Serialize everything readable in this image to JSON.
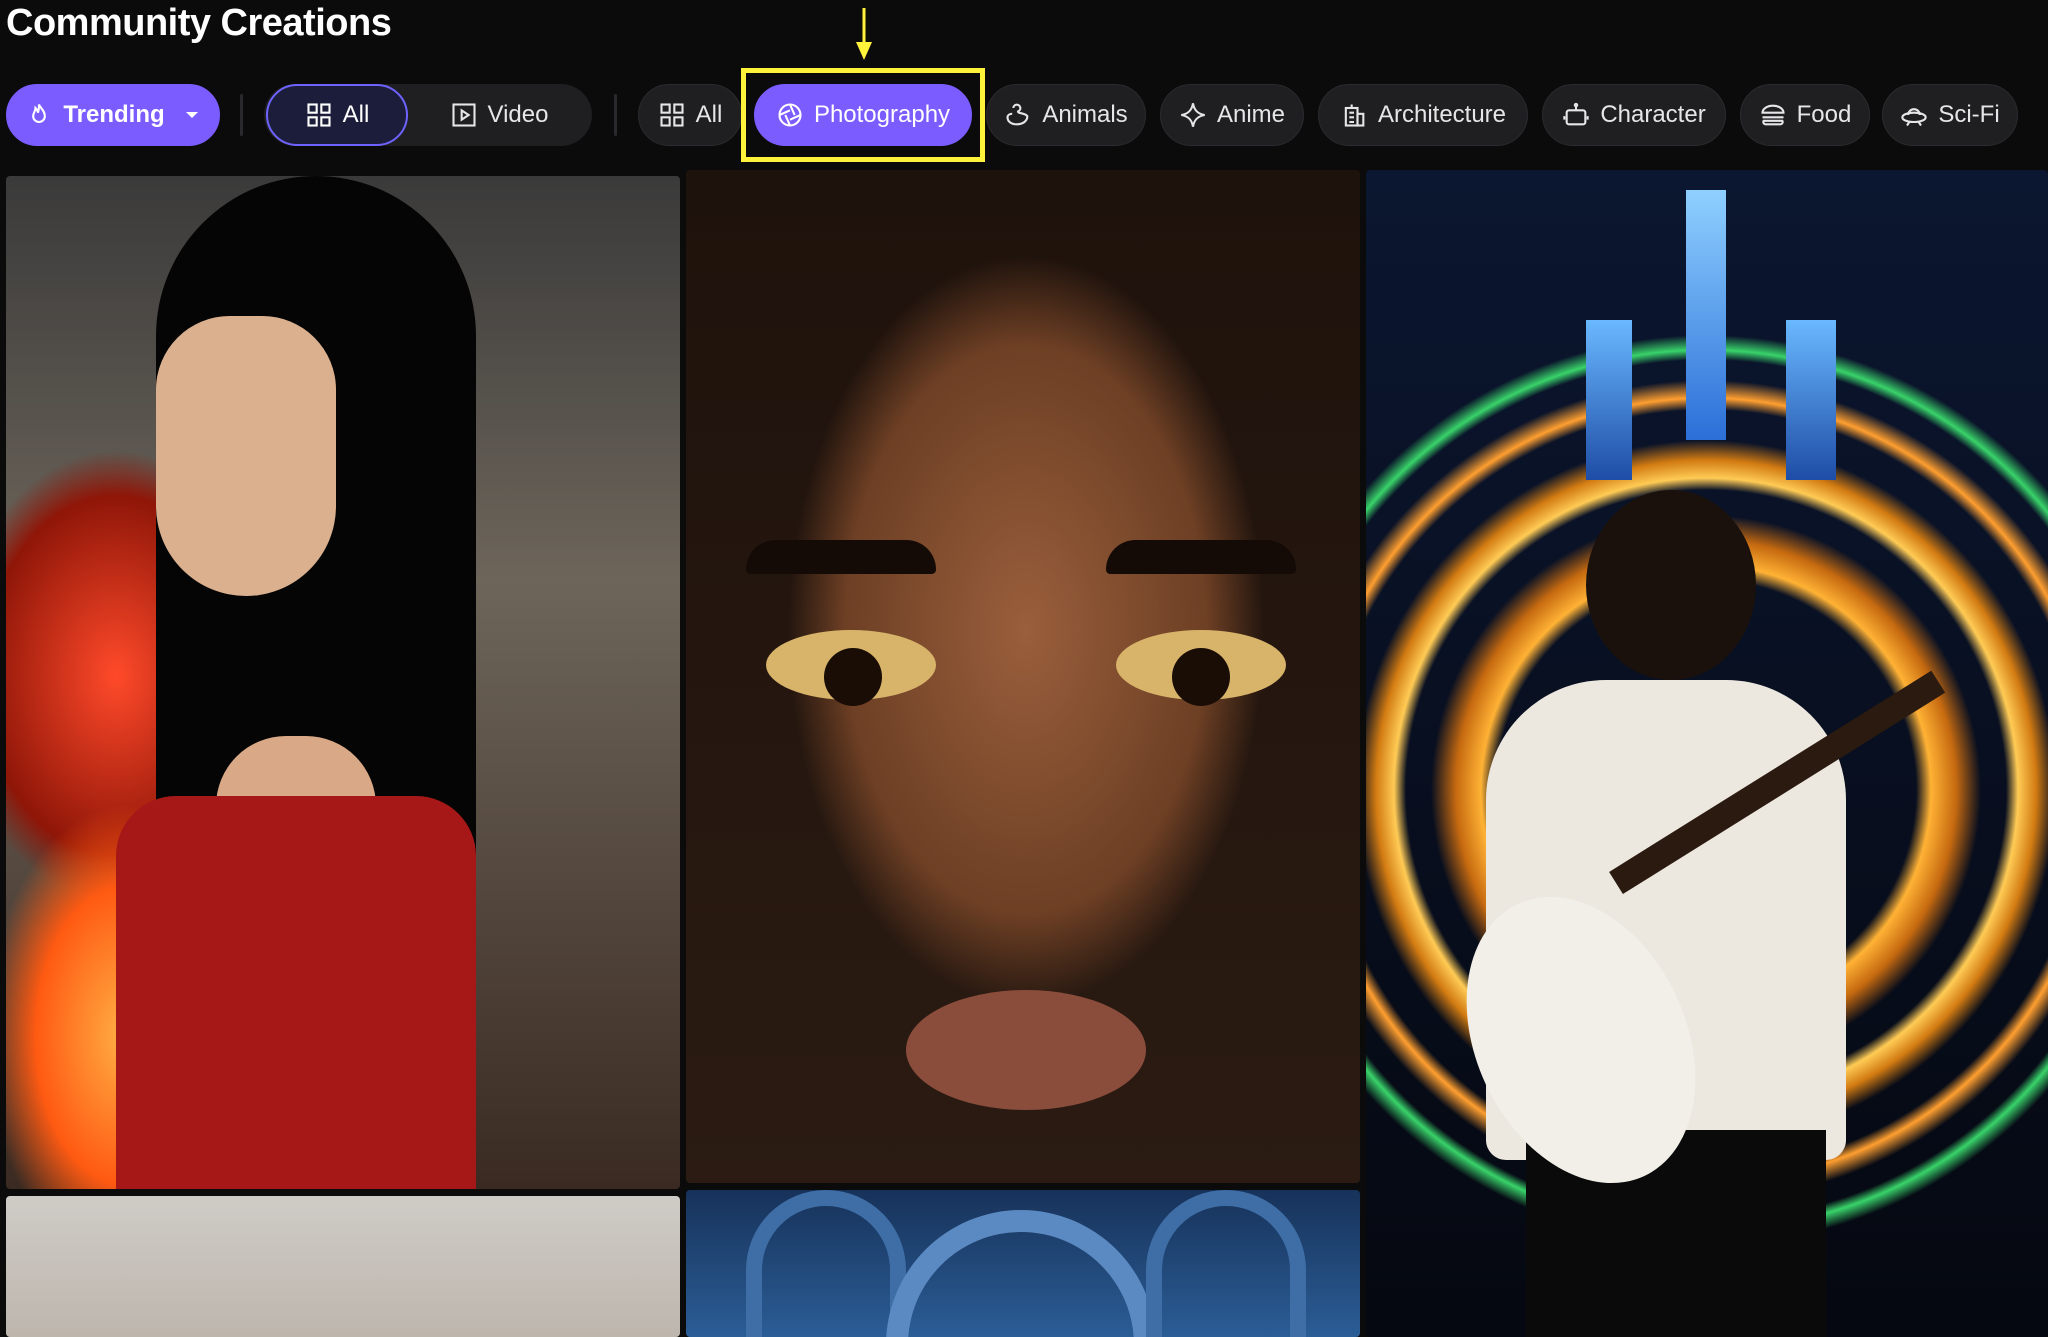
{
  "page": {
    "title": "Community Creations"
  },
  "filters": {
    "sort": {
      "label": "Trending",
      "icon": "flame-icon"
    },
    "media_type": {
      "options": [
        {
          "label": "All",
          "icon": "grid-icon",
          "selected": true
        },
        {
          "label": "Video",
          "icon": "play-square-icon",
          "selected": false
        }
      ]
    },
    "categories": [
      {
        "label": "All",
        "icon": "grid-icon",
        "selected": false
      },
      {
        "label": "Photography",
        "icon": "aperture-icon",
        "selected": true
      },
      {
        "label": "Animals",
        "icon": "duck-icon",
        "selected": false
      },
      {
        "label": "Anime",
        "icon": "sparkle-icon",
        "selected": false
      },
      {
        "label": "Architecture",
        "icon": "building-icon",
        "selected": false
      },
      {
        "label": "Character",
        "icon": "robot-icon",
        "selected": false
      },
      {
        "label": "Food",
        "icon": "burger-icon",
        "selected": false
      },
      {
        "label": "Sci-Fi",
        "icon": "ufo-icon",
        "selected": false
      }
    ]
  },
  "colors": {
    "accent": "#7b5cff",
    "background": "#0b0b0c",
    "pill": "#1f1f22",
    "highlight_box": "#fff23a"
  }
}
